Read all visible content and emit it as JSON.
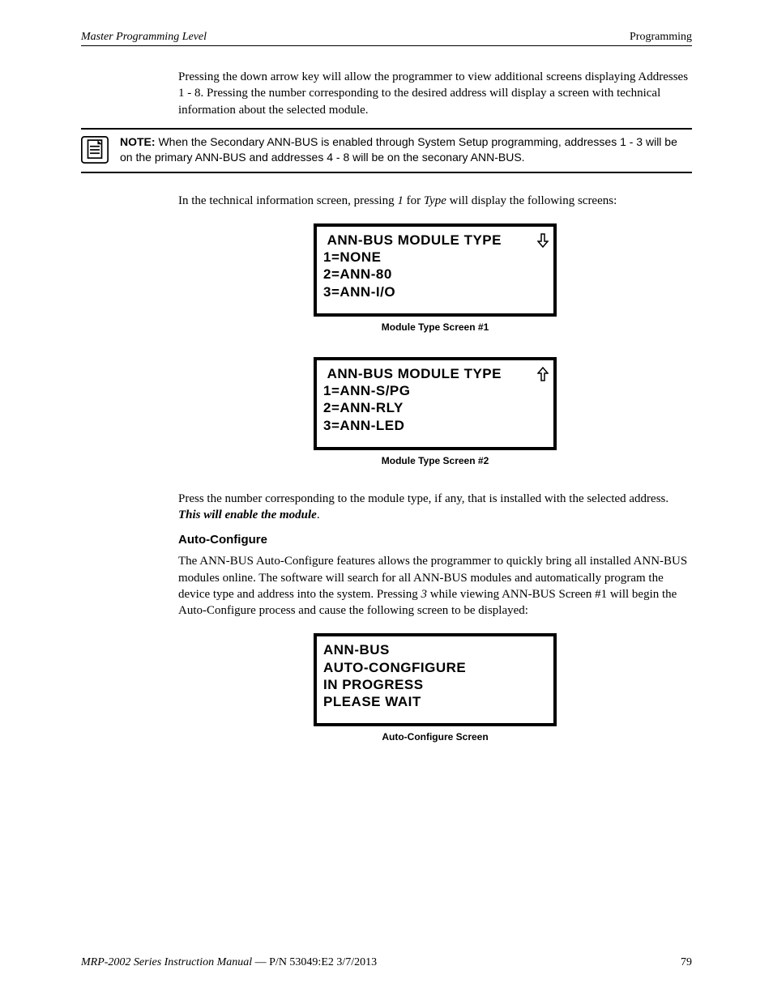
{
  "header": {
    "left": "Master Programming Level",
    "right": "Programming"
  },
  "para1": "Pressing the down arrow key will allow the programmer to view additional screens displaying Addresses 1 - 8.  Pressing the number corresponding to the desired address will display a screen with technical information about the selected module.",
  "note": {
    "label": "NOTE:",
    "text": "  When the Secondary ANN-BUS is enabled through System Setup programming, addresses 1 - 3 will be on the primary ANN-BUS and addresses 4 - 8 will be on the seconary ANN-BUS."
  },
  "para2_pre": "In the technical information screen, pressing ",
  "para2_i1": "1",
  "para2_mid": " for ",
  "para2_i2": "Type",
  "para2_post": " will display the following screens:",
  "screen1": {
    "line1": " ANN-BUS MODULE TYPE",
    "line2": "1=NONE",
    "line3": "2=ANN-80",
    "line4": "3=ANN-I/O",
    "caption": "Module Type Screen #1",
    "arrow": "down"
  },
  "screen2": {
    "line1": " ANN-BUS MODULE TYPE",
    "line2": "1=ANN-S/PG",
    "line3": "2=ANN-RLY",
    "line4": "3=ANN-LED",
    "caption": "Module Type Screen #2",
    "arrow": "up"
  },
  "para3_pre": "Press the number corresponding to the module type, if any, that is installed with the selected address.  ",
  "para3_bi": "This will enable the module",
  "para3_post": ".",
  "section_heading": "Auto-Configure",
  "para4_pre": "The ANN-BUS Auto-Configure features allows the programmer to quickly bring all installed ANN-BUS modules online.  The software will search for all ANN-BUS modules and automatically program the device type and address into the system.  Pressing ",
  "para4_i1": "3",
  "para4_post": " while viewing ANN-BUS Screen #1 will begin the Auto-Configure process and cause the following screen to be displayed:",
  "screen3": {
    "line1": "ANN-BUS",
    "line2": "AUTO-CONGFIGURE",
    "line3": "IN PROGRESS",
    "line4": "PLEASE WAIT",
    "caption": "Auto-Configure Screen"
  },
  "footer": {
    "manual_title": "MRP-2002 Series Instruction Manual",
    "sep": " — ",
    "pn": "P/N 53049:E2  3/7/2013",
    "page": "79"
  }
}
